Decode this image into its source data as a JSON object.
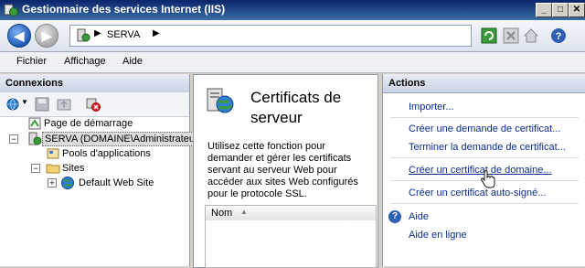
{
  "window": {
    "title": "Gestionnaire des services Internet (IIS)",
    "buttons": {
      "minimize": "_",
      "maximize": "□",
      "close": "✕"
    }
  },
  "address": {
    "separator": "▶",
    "crumb": "SERVA"
  },
  "menu": {
    "file": "Fichier",
    "view": "Affichage",
    "help": "Aide"
  },
  "connections": {
    "header": "Connexions",
    "tree": {
      "start_page": "Page de démarrage",
      "server": "SERVA (DOMAINE\\Administrateu",
      "app_pools": "Pools d'applications",
      "sites": "Sites",
      "default_site": "Default Web Site"
    }
  },
  "center": {
    "title_line1": "Certificats de",
    "title_line2": "serveur",
    "description": "Utilisez cette fonction pour demander et gérer les certificats servant au serveur Web pour accéder aux sites Web configurés pour le protocole SSL.",
    "grid_header": "Nom"
  },
  "actions": {
    "header": "Actions",
    "import": "Importer...",
    "create_request": "Créer une demande de certificat...",
    "complete_request": "Terminer la demande de certificat...",
    "create_domain_cert": "Créer un certificat de domaine...",
    "create_self_signed": "Créer un certificat auto-signé...",
    "help": "Aide",
    "online_help": "Aide en ligne"
  },
  "icons": {
    "back": "back-arrow-icon",
    "forward": "forward-arrow-icon",
    "help_glyph": "?"
  },
  "colors": {
    "titlebar": "#0a246a",
    "link": "#0b2c8f",
    "help_icon": "#2f5fb3"
  }
}
